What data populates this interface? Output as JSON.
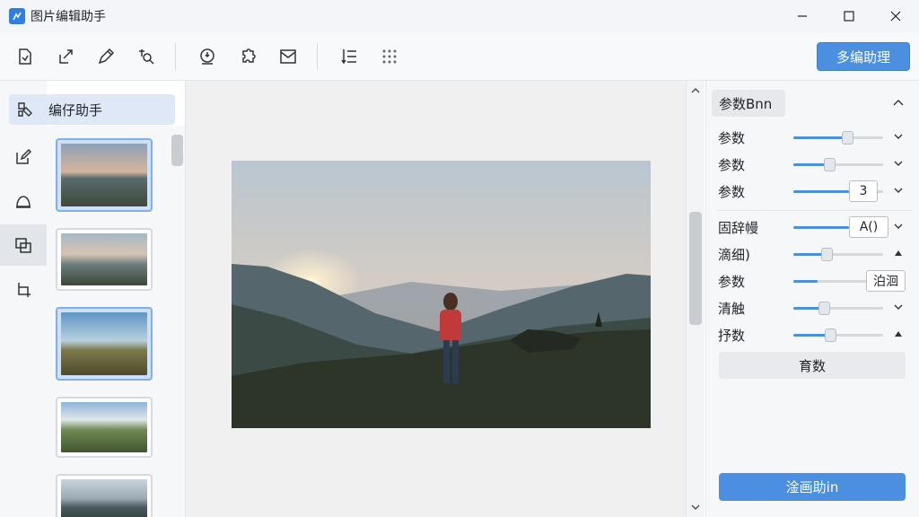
{
  "window": {
    "title": "图片编辑助手",
    "accent": "#4a8fe0"
  },
  "toolbar": {
    "tools": [
      {
        "icon": "document-icon"
      },
      {
        "icon": "export-icon"
      },
      {
        "icon": "pen-icon"
      },
      {
        "icon": "crop-lasso-icon"
      },
      {
        "icon": "info-download-icon"
      },
      {
        "icon": "puzzle-icon"
      },
      {
        "icon": "image-mail-icon"
      },
      {
        "icon": "list-sort-icon"
      },
      {
        "icon": "grid-dots-icon"
      }
    ],
    "primary_label": "多编助理"
  },
  "sidebar": {
    "assistant_tab_label": "编仔助手",
    "rail": [
      {
        "icon": "edit-icon",
        "active": false
      },
      {
        "icon": "shape-icon",
        "active": false
      },
      {
        "icon": "copy-gallery-icon",
        "active": true
      },
      {
        "icon": "crop-icon",
        "active": false
      }
    ]
  },
  "thumbnails": [
    {
      "scene": "mountain-sunrise",
      "selected": true
    },
    {
      "scene": "misty-valley",
      "selected": false
    },
    {
      "scene": "blue-sky-hill",
      "selected": true
    },
    {
      "scene": "forest-path",
      "selected": false
    },
    {
      "scene": "mountain-lake",
      "selected": false
    }
  ],
  "right_panel": {
    "header": "参数Bnn",
    "params": [
      {
        "label": "参数",
        "value": 0.6,
        "value_text": "",
        "ctrl": "chevron-down"
      },
      {
        "label": "参数",
        "value": 0.4,
        "value_text": "",
        "ctrl": "chevron-down"
      },
      {
        "label": "参数",
        "value": 0.62,
        "value_text": "3",
        "ctrl": "chevron-down"
      },
      {
        "label": "固辞幔",
        "value": 0.62,
        "value_text": "A()",
        "ctrl": "chevron-down"
      },
      {
        "label": "滴细)",
        "value": 0.37,
        "value_text": "",
        "ctrl": "triangle-up"
      },
      {
        "label": "参数",
        "value": 0.27,
        "value_text": "泊洄",
        "ctrl": ""
      },
      {
        "label": "清触",
        "value": 0.34,
        "value_text": "",
        "ctrl": "chevron-down"
      },
      {
        "label": "抒数",
        "value": 0.41,
        "value_text": "",
        "ctrl": "triangle-up"
      }
    ],
    "reset_label": "育数",
    "apply_label": "淦画助in"
  }
}
